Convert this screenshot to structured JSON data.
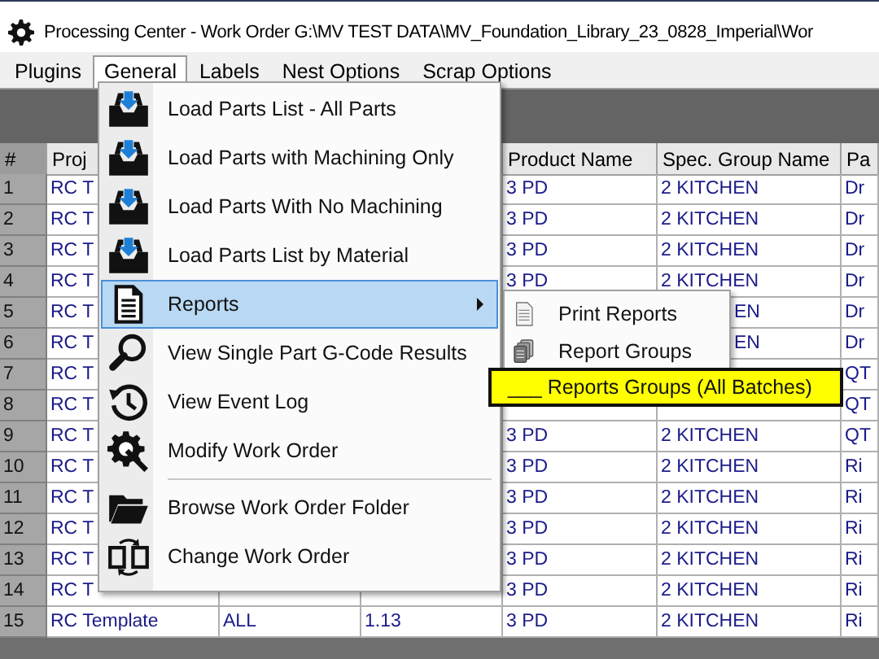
{
  "window": {
    "title": "Processing Center - Work Order G:\\MV TEST DATA\\MV_Foundation_Library_23_0828_Imperial\\Wor"
  },
  "menu_bar": [
    {
      "label": "Plugins",
      "selected": false
    },
    {
      "label": "General",
      "selected": true
    },
    {
      "label": "Labels",
      "selected": false
    },
    {
      "label": "Nest Options",
      "selected": false
    },
    {
      "label": "Scrap Options",
      "selected": false
    }
  ],
  "table": {
    "columns": {
      "number": "#",
      "column_2": "Proj",
      "product_name": "Product Name",
      "spec_group_name": "Spec. Group Name",
      "column_7": "Pa"
    },
    "rows": [
      {
        "number": "1",
        "column_2": "RC T",
        "product_name": "3 PD",
        "spec_group_name": "2 KITCHEN",
        "column_7": "Dr"
      },
      {
        "number": "2",
        "column_2": "RC T",
        "product_name": "3 PD",
        "spec_group_name": "2 KITCHEN",
        "column_7": "Dr"
      },
      {
        "number": "3",
        "column_2": "RC T",
        "product_name": "3 PD",
        "spec_group_name": "2 KITCHEN",
        "column_7": "Dr"
      },
      {
        "number": "4",
        "column_2": "RC T",
        "product_name": "3 PD",
        "spec_group_name": "2 KITCHEN",
        "column_7": "Dr"
      },
      {
        "number": "5",
        "column_2": "RC T",
        "spec_group_name": "EN",
        "spec_clipped": true,
        "column_7": "Dr"
      },
      {
        "number": "6",
        "column_2": "RC T",
        "spec_group_name": "EN",
        "spec_clipped": true,
        "column_7": "Dr"
      },
      {
        "number": "7",
        "column_2": "RC T",
        "column_7": "QT"
      },
      {
        "number": "8",
        "column_2": "RC T",
        "column_7": "QT"
      },
      {
        "number": "9",
        "column_2": "RC T",
        "product_name": "3 PD",
        "spec_group_name": "2 KITCHEN",
        "column_7": "QT"
      },
      {
        "number": "10",
        "column_2": "RC T",
        "product_name": "3 PD",
        "spec_group_name": "2 KITCHEN",
        "column_7": "Ri"
      },
      {
        "number": "11",
        "column_2": "RC T",
        "product_name": "3 PD",
        "spec_group_name": "2 KITCHEN",
        "column_7": "Ri"
      },
      {
        "number": "12",
        "column_2": "RC T",
        "product_name": "3 PD",
        "spec_group_name": "2 KITCHEN",
        "column_7": "Ri"
      },
      {
        "number": "13",
        "column_2": "RC T",
        "product_name": "3 PD",
        "spec_group_name": "2 KITCHEN",
        "column_7": "Ri"
      },
      {
        "number": "14",
        "column_2": "RC T",
        "product_name": "3 PD",
        "spec_group_name": "2 KITCHEN",
        "column_7": "Ri"
      },
      {
        "number": "15",
        "column_2": "RC Template",
        "column_3": "ALL",
        "column_4": "1.13",
        "product_name": "3 PD",
        "spec_group_name": "2 KITCHEN",
        "column_7": "Ri"
      }
    ]
  },
  "menu": {
    "items": [
      {
        "label": "Load Parts List - All Parts",
        "kind": "tray",
        "selected": false,
        "submenu": false,
        "separator_before": false
      },
      {
        "label": "Load Parts with Machining Only",
        "kind": "tray",
        "selected": false,
        "submenu": false,
        "separator_before": false
      },
      {
        "label": "Load Parts With No Machining",
        "kind": "tray",
        "selected": false,
        "submenu": false,
        "separator_before": false
      },
      {
        "label": "Load Parts List by Material",
        "kind": "tray",
        "selected": false,
        "submenu": false,
        "separator_before": false
      },
      {
        "label": "Reports",
        "kind": "document",
        "selected": true,
        "submenu": true,
        "separator_before": false
      },
      {
        "label": "View Single Part G-Code Results",
        "kind": "magnifier",
        "selected": false,
        "submenu": false,
        "separator_before": false
      },
      {
        "label": "View Event Log",
        "kind": "history",
        "selected": false,
        "submenu": false,
        "separator_before": false
      },
      {
        "label": "Modify Work Order",
        "kind": "gear-wrench",
        "selected": false,
        "submenu": false,
        "separator_before": false
      },
      {
        "label": "Browse Work Order Folder",
        "kind": "folder",
        "selected": false,
        "submenu": false,
        "separator_before": true
      },
      {
        "label": "Change Work Order",
        "kind": "swap",
        "selected": false,
        "submenu": false,
        "separator_before": false
      }
    ]
  },
  "submenu": {
    "items": [
      {
        "label": "Print Reports",
        "kind": "page"
      },
      {
        "label": "Report Groups",
        "kind": "stack"
      }
    ]
  },
  "highlight_box": {
    "label": "___ Reports Groups (All Batches)"
  }
}
